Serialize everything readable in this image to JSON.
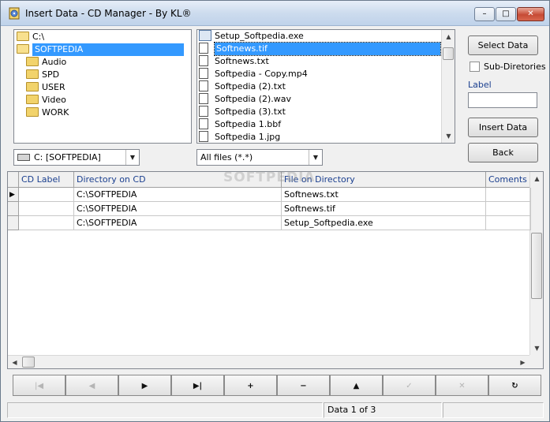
{
  "window": {
    "title": "Insert Data - CD Manager - By KL®",
    "minimize_glyph": "–",
    "maximize_glyph": "□",
    "close_glyph": "✕"
  },
  "directory_tree": {
    "items": [
      {
        "label": "C:\\",
        "icon": "folder-open-icon"
      },
      {
        "label": "SOFTPEDIA",
        "icon": "folder-open-icon",
        "selected": true
      },
      {
        "label": "Audio",
        "icon": "folder-icon"
      },
      {
        "label": "SPD",
        "icon": "folder-icon"
      },
      {
        "label": "USER",
        "icon": "folder-icon"
      },
      {
        "label": "Video",
        "icon": "folder-icon"
      },
      {
        "label": "WORK",
        "icon": "folder-icon"
      }
    ]
  },
  "file_list": {
    "items": [
      {
        "label": "Setup_Softpedia.exe",
        "icon": "exe-icon"
      },
      {
        "label": "Softnews.tif",
        "icon": "file-icon",
        "selected": true
      },
      {
        "label": "Softnews.txt",
        "icon": "file-icon"
      },
      {
        "label": "Softpedia - Copy.mp4",
        "icon": "file-icon"
      },
      {
        "label": "Softpedia (2).txt",
        "icon": "file-icon"
      },
      {
        "label": "Softpedia (2).wav",
        "icon": "file-icon"
      },
      {
        "label": "Softpedia (3).txt",
        "icon": "file-icon"
      },
      {
        "label": "Softpedia 1.bbf",
        "icon": "file-icon"
      },
      {
        "label": "Softpedia 1.jpg",
        "icon": "file-icon"
      }
    ]
  },
  "drive_combo": {
    "value": "C: [SOFTPEDIA]",
    "icon": "drive-icon"
  },
  "filter_combo": {
    "value": "All files (*.*)"
  },
  "side": {
    "select_data": "Select Data",
    "sub_directories": "Sub-Diretories",
    "label_caption": "Label",
    "label_value": "",
    "insert_data": "Insert Data",
    "back": "Back"
  },
  "grid": {
    "columns": [
      "CD Label",
      "Directory on CD",
      "File on Directory",
      "Coments of"
    ],
    "rows": [
      {
        "cd_label": "",
        "directory": "C:\\SOFTPEDIA",
        "file": "Softnews.txt",
        "comments": ""
      },
      {
        "cd_label": "",
        "directory": "C:\\SOFTPEDIA",
        "file": "Softnews.tif",
        "comments": ""
      },
      {
        "cd_label": "",
        "directory": "C:\\SOFTPEDIA",
        "file": "Setup_Softpedia.exe",
        "comments": ""
      }
    ],
    "current_row_marker": "▶"
  },
  "navigator": {
    "buttons": [
      {
        "name": "first",
        "glyph": "|◀",
        "icon": "first-record-icon",
        "enabled": false
      },
      {
        "name": "prior",
        "glyph": "◀",
        "icon": "prior-record-icon",
        "enabled": false
      },
      {
        "name": "next",
        "glyph": "▶",
        "icon": "next-record-icon",
        "enabled": true
      },
      {
        "name": "last",
        "glyph": "▶|",
        "icon": "last-record-icon",
        "enabled": true
      },
      {
        "name": "insert",
        "glyph": "+",
        "icon": "plus-icon",
        "enabled": true
      },
      {
        "name": "delete",
        "glyph": "−",
        "icon": "minus-icon",
        "enabled": true
      },
      {
        "name": "edit",
        "glyph": "▲",
        "icon": "edit-icon",
        "enabled": true
      },
      {
        "name": "post",
        "glyph": "✓",
        "icon": "check-icon",
        "enabled": false
      },
      {
        "name": "cancel",
        "glyph": "✕",
        "icon": "cancel-icon",
        "enabled": false
      },
      {
        "name": "refresh",
        "glyph": "↻",
        "icon": "refresh-icon",
        "enabled": true
      }
    ]
  },
  "status": {
    "record_text": "Data 1 of 3"
  },
  "watermark": "SOFTPEDIA"
}
